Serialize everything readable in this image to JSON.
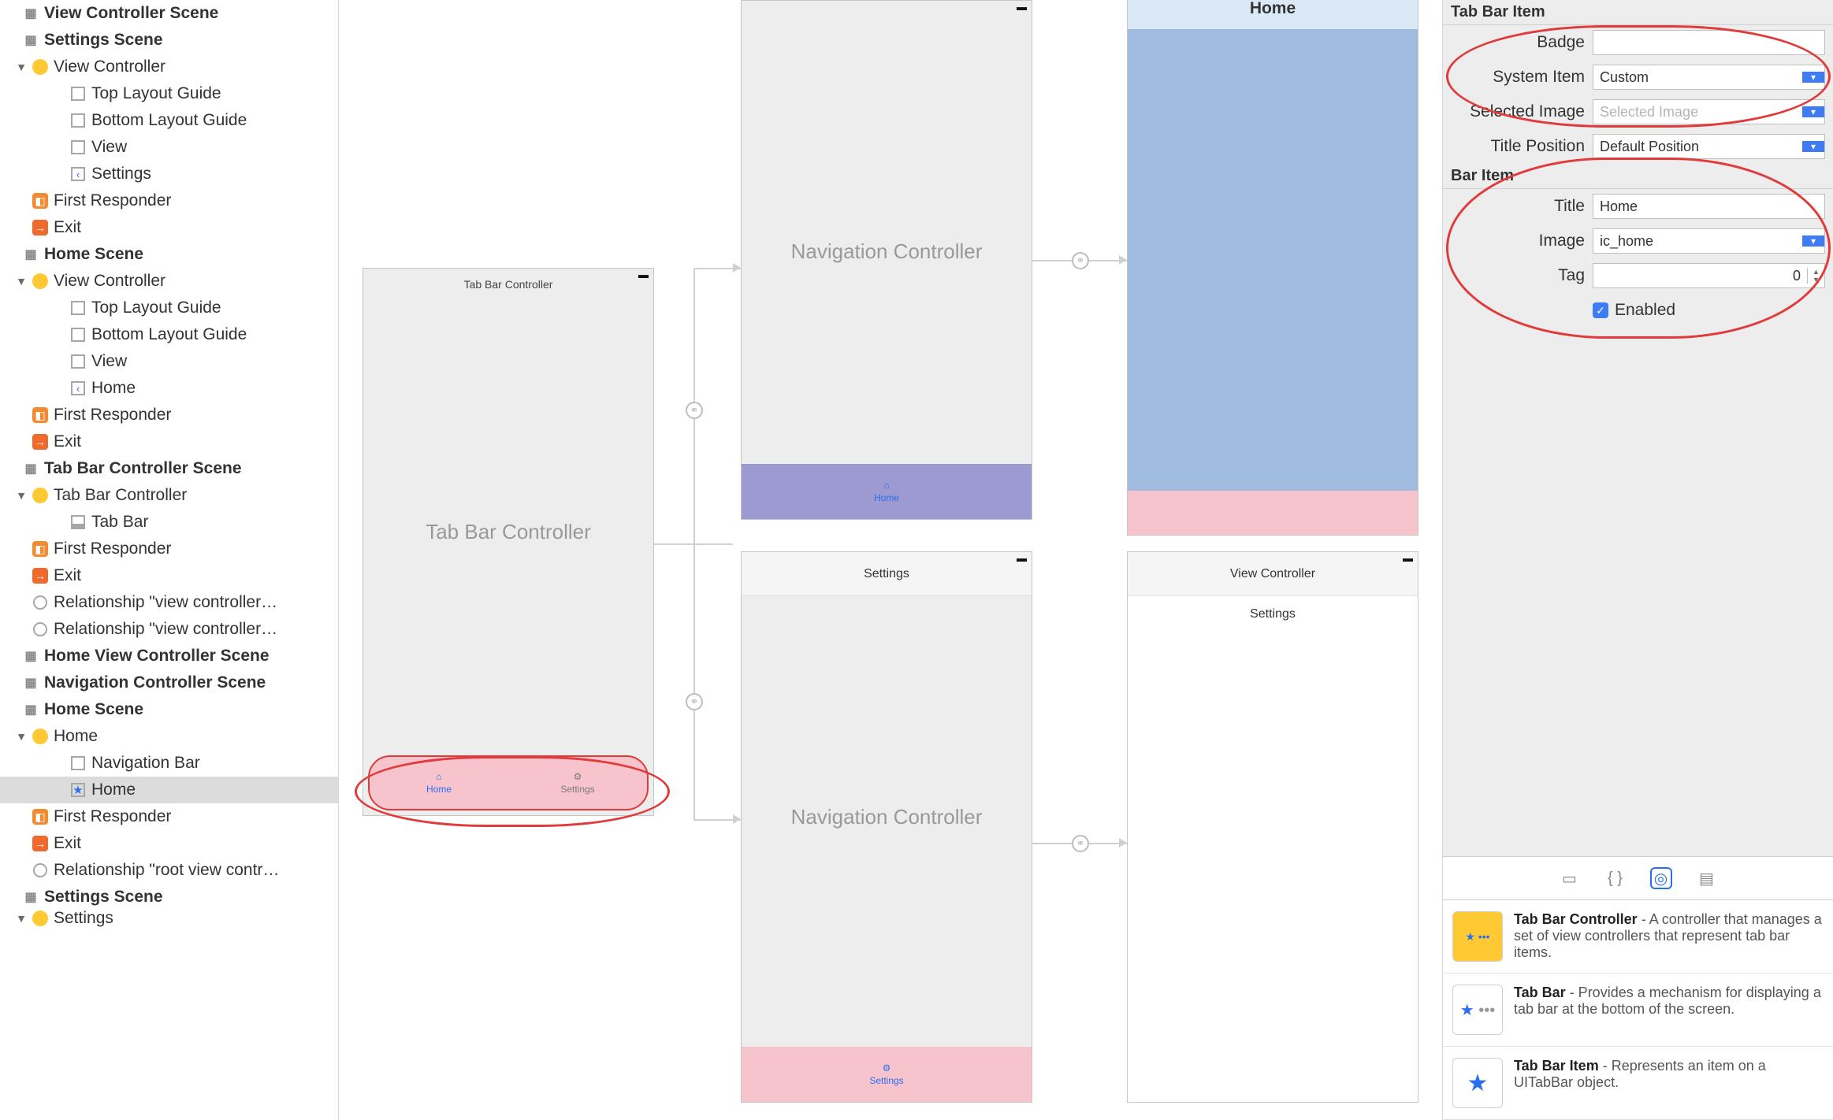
{
  "outline": {
    "scenes": [
      {
        "label": "View Controller Scene",
        "bold": true,
        "icon": "scene"
      },
      {
        "label": "Settings Scene",
        "bold": true,
        "icon": "scene"
      },
      {
        "label": "View Controller",
        "indent": 2,
        "icon": "yellow",
        "arrow": "down"
      },
      {
        "label": "Top Layout Guide",
        "indent": 3,
        "icon": "square"
      },
      {
        "label": "Bottom Layout Guide",
        "indent": 3,
        "icon": "square"
      },
      {
        "label": "View",
        "indent": 3,
        "icon": "square"
      },
      {
        "label": "Settings",
        "indent": 3,
        "icon": "chev"
      },
      {
        "label": "First Responder",
        "indent": 2,
        "icon": "cube"
      },
      {
        "label": "Exit",
        "indent": 2,
        "icon": "exit"
      },
      {
        "label": "Home Scene",
        "bold": true,
        "icon": "scene"
      },
      {
        "label": "View Controller",
        "indent": 2,
        "icon": "yellow",
        "arrow": "down"
      },
      {
        "label": "Top Layout Guide",
        "indent": 3,
        "icon": "square"
      },
      {
        "label": "Bottom Layout Guide",
        "indent": 3,
        "icon": "square"
      },
      {
        "label": "View",
        "indent": 3,
        "icon": "square"
      },
      {
        "label": "Home",
        "indent": 3,
        "icon": "chev"
      },
      {
        "label": "First Responder",
        "indent": 2,
        "icon": "cube"
      },
      {
        "label": "Exit",
        "indent": 2,
        "icon": "exit"
      },
      {
        "label": "Tab Bar Controller Scene",
        "bold": true,
        "icon": "scene"
      },
      {
        "label": "Tab Bar Controller",
        "indent": 2,
        "icon": "yellow",
        "arrow": "down"
      },
      {
        "label": "Tab Bar",
        "indent": 3,
        "icon": "tabbar"
      },
      {
        "label": "First Responder",
        "indent": 2,
        "icon": "cube"
      },
      {
        "label": "Exit",
        "indent": 2,
        "icon": "exit"
      },
      {
        "label": "Relationship \"view controller…",
        "indent": 2,
        "icon": "rel"
      },
      {
        "label": "Relationship \"view controller…",
        "indent": 2,
        "icon": "rel"
      },
      {
        "label": "Home View Controller Scene",
        "bold": true,
        "icon": "scene"
      },
      {
        "label": "Navigation Controller Scene",
        "bold": true,
        "icon": "scene"
      },
      {
        "label": "Home Scene",
        "bold": true,
        "icon": "scene"
      },
      {
        "label": "Home",
        "indent": 2,
        "icon": "yellow",
        "arrow": "down"
      },
      {
        "label": "Navigation Bar",
        "indent": 3,
        "icon": "square"
      },
      {
        "label": "Home",
        "indent": 3,
        "icon": "star",
        "selected": true
      },
      {
        "label": "First Responder",
        "indent": 2,
        "icon": "cube"
      },
      {
        "label": "Exit",
        "indent": 2,
        "icon": "exit"
      },
      {
        "label": "Relationship \"root view contr…",
        "indent": 2,
        "icon": "rel"
      },
      {
        "label": "Settings Scene",
        "bold": true,
        "icon": "scene"
      },
      {
        "label": "Settings",
        "indent": 2,
        "icon": "yellow",
        "arrow": "down",
        "cut": true
      }
    ]
  },
  "canvas": {
    "tabbarctrl": {
      "title": "Tab Bar Controller",
      "center": "Tab Bar Controller",
      "tabs": [
        {
          "icon": "⌂",
          "label": "Home",
          "active": true
        },
        {
          "icon": "⚙",
          "label": "Settings",
          "active": false
        }
      ]
    },
    "nav1": {
      "center": "Navigation Controller",
      "bottom_icon": "⌂",
      "bottom_label": "Home"
    },
    "nav2": {
      "title": "Settings",
      "center": "Navigation Controller",
      "bottom_icon": "⚙",
      "bottom_label": "Settings"
    },
    "home": {
      "toplabel": "Home"
    },
    "settings_vc": {
      "title": "View Controller",
      "nav": "Settings"
    }
  },
  "inspector": {
    "tab_bar_item": {
      "header": "Tab Bar Item",
      "badge_label": "Badge",
      "badge": "",
      "system_item_label": "System Item",
      "system_item": "Custom",
      "selected_image_label": "Selected Image",
      "selected_image_placeholder": "Selected Image",
      "title_position_label": "Title Position",
      "title_position": "Default Position"
    },
    "bar_item": {
      "header": "Bar Item",
      "title_label": "Title",
      "title": "Home",
      "image_label": "Image",
      "image": "ic_home",
      "tag_label": "Tag",
      "tag": "0",
      "enabled_label": "Enabled"
    },
    "library": [
      {
        "title": "Tab Bar Controller",
        "desc": " - A controller that manages a set of view controllers that represent tab bar items.",
        "thumb": "yellow-star"
      },
      {
        "title": "Tab Bar",
        "desc": " - Provides a mechanism for displaying a tab bar at the bottom of the screen.",
        "thumb": "star-dots"
      },
      {
        "title": "Tab Bar Item",
        "desc": " - Represents an item on a UITabBar object.",
        "thumb": "star"
      }
    ]
  }
}
